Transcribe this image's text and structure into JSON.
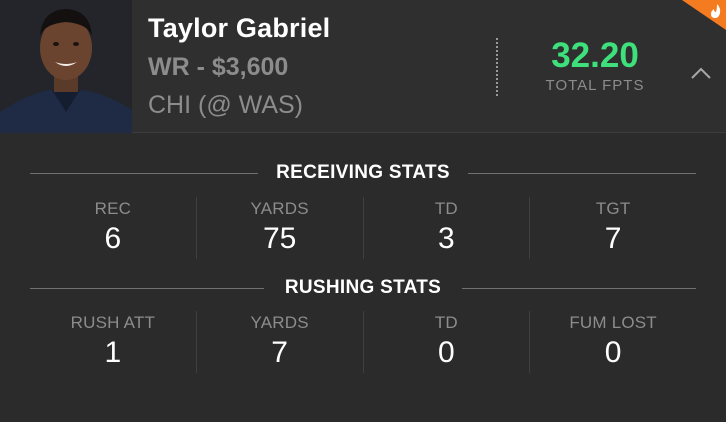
{
  "player": {
    "name": "Taylor Gabriel",
    "position_salary": "WR - $3,600",
    "game": "CHI (@ WAS)"
  },
  "fpts": {
    "value": "32.20",
    "label": "TOTAL FPTS"
  },
  "colors": {
    "accent_green": "#3de07a",
    "badge_orange": "#f47b20",
    "background": "#2b2b2b"
  },
  "icons": {
    "collapse": "chevron-up-icon",
    "badge": "flame-icon"
  },
  "receiving": {
    "title": "RECEIVING STATS",
    "stats": [
      {
        "label": "REC",
        "value": "6"
      },
      {
        "label": "YARDS",
        "value": "75"
      },
      {
        "label": "TD",
        "value": "3"
      },
      {
        "label": "TGT",
        "value": "7"
      }
    ]
  },
  "rushing": {
    "title": "RUSHING STATS",
    "stats": [
      {
        "label": "RUSH ATT",
        "value": "1"
      },
      {
        "label": "YARDS",
        "value": "7"
      },
      {
        "label": "TD",
        "value": "0"
      },
      {
        "label": "FUM LOST",
        "value": "0"
      }
    ]
  }
}
